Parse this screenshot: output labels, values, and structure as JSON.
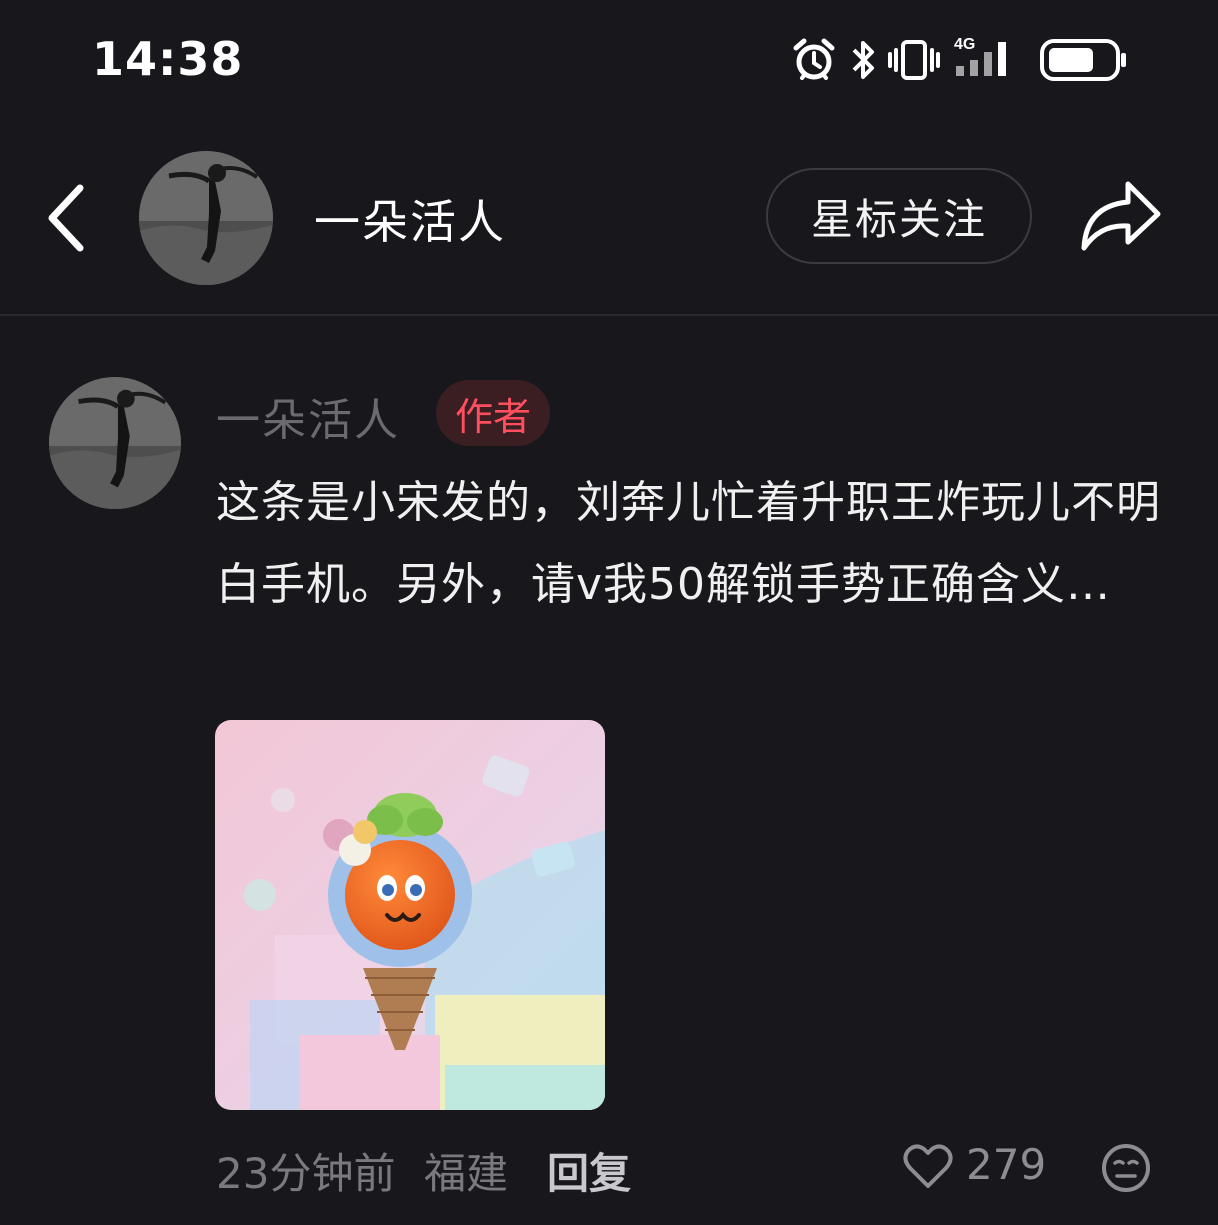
{
  "status_bar": {
    "time": "14:38",
    "icons": [
      "alarm-icon",
      "bluetooth-icon",
      "vibrate-icon",
      "signal-icon",
      "battery-icon"
    ],
    "network_label": "4G"
  },
  "header": {
    "title": "一朵活人",
    "follow_label": "星标关注"
  },
  "comment": {
    "author": "一朵活人",
    "badge": "作者",
    "text": "这条是小宋发的，刘奔儿忙着升职王炸玩儿不明白手机。另外，请v我50解锁手势正确含义…",
    "time": "23分钟前",
    "location": "福建",
    "reply_label": "回复",
    "like_count": "279"
  },
  "colors": {
    "background": "#18171c",
    "badge_text": "#ff4f5f",
    "badge_bg": "#3a1e22",
    "muted": "#7a7980"
  }
}
